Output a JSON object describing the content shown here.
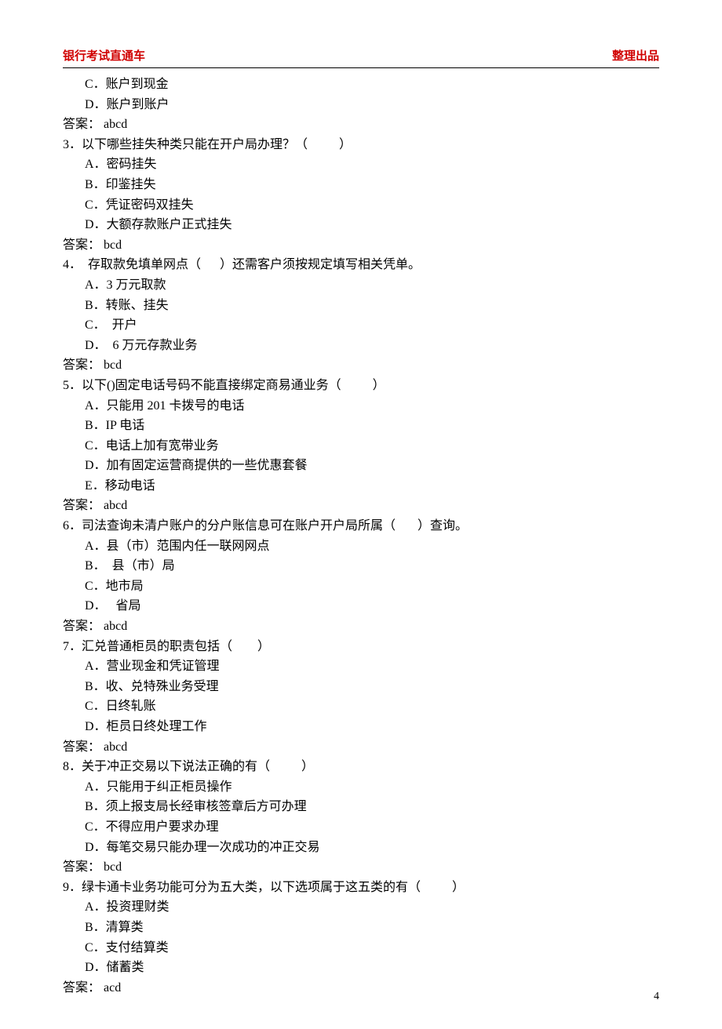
{
  "header": {
    "left": "银行考试直通车",
    "right": "整理出品"
  },
  "lines": [
    {
      "cls": "opt",
      "text": "C．账户到现金"
    },
    {
      "cls": "opt",
      "text": "D．账户到账户"
    },
    {
      "cls": "ans",
      "text": "答案： abcd"
    },
    {
      "cls": "q",
      "text": "3．以下哪些挂失种类只能在开户局办理？（          ）"
    },
    {
      "cls": "opt",
      "text": "A．密码挂失"
    },
    {
      "cls": "opt",
      "text": "B．印鉴挂失"
    },
    {
      "cls": "opt",
      "text": "C．凭证密码双挂失"
    },
    {
      "cls": "opt",
      "text": "D．大额存款账户正式挂失"
    },
    {
      "cls": "ans",
      "text": "答案： bcd"
    },
    {
      "cls": "q",
      "text": "4．  存取款免填单网点（      ）还需客户须按规定填写相关凭单。"
    },
    {
      "cls": "opt",
      "text": "A．3 万元取款"
    },
    {
      "cls": "opt",
      "text": "B．转账、挂失"
    },
    {
      "cls": "opt",
      "text": "C．  开户"
    },
    {
      "cls": "opt",
      "text": "D．  6 万元存款业务"
    },
    {
      "cls": "ans",
      "text": "答案： bcd"
    },
    {
      "cls": "q",
      "text": "5．以下()固定电话号码不能直接绑定商易通业务（          ）"
    },
    {
      "cls": "opt",
      "text": "A．只能用 201 卡拨号的电话"
    },
    {
      "cls": "opt",
      "text": "B．IP 电话"
    },
    {
      "cls": "opt",
      "text": "C．电话上加有宽带业务"
    },
    {
      "cls": "opt",
      "text": "D．加有固定运营商提供的一些优惠套餐"
    },
    {
      "cls": "opt",
      "text": "E．移动电话"
    },
    {
      "cls": "ans",
      "text": "答案： abcd"
    },
    {
      "cls": "q",
      "text": "6．司法查询未清户账户的分户账信息可在账户开户局所属（       ）查询。"
    },
    {
      "cls": "opt",
      "text": "A．县（市）范围内任一联网网点"
    },
    {
      "cls": "opt",
      "text": "B．  县（市）局"
    },
    {
      "cls": "opt",
      "text": "C．地市局"
    },
    {
      "cls": "opt",
      "text": "D．   省局"
    },
    {
      "cls": "ans",
      "text": "答案： abcd"
    },
    {
      "cls": "q",
      "text": "7．汇兑普通柜员的职责包括（        ）"
    },
    {
      "cls": "opt",
      "text": "A．营业现金和凭证管理"
    },
    {
      "cls": "opt",
      "text": "B．收、兑特殊业务受理"
    },
    {
      "cls": "opt",
      "text": "C．日终轧账"
    },
    {
      "cls": "opt",
      "text": "D．柜员日终处理工作"
    },
    {
      "cls": "ans",
      "text": "答案： abcd"
    },
    {
      "cls": "q",
      "text": "8．关于冲正交易以下说法正确的有（          ）"
    },
    {
      "cls": "opt",
      "text": "A．只能用于纠正柜员操作"
    },
    {
      "cls": "opt",
      "text": "B．须上报支局长经审核签章后方可办理"
    },
    {
      "cls": "opt",
      "text": "C．不得应用户要求办理"
    },
    {
      "cls": "opt",
      "text": "D．每笔交易只能办理一次成功的冲正交易"
    },
    {
      "cls": "ans",
      "text": "答案： bcd"
    },
    {
      "cls": "q",
      "text": "9．绿卡通卡业务功能可分为五大类，以下选项属于这五类的有（          ）"
    },
    {
      "cls": "opt",
      "text": "A．投资理财类"
    },
    {
      "cls": "opt",
      "text": "B．清算类"
    },
    {
      "cls": "opt",
      "text": "C．支付结算类"
    },
    {
      "cls": "opt",
      "text": "D．储蓄类"
    },
    {
      "cls": "ans",
      "text": "答案： acd"
    }
  ],
  "page_number": "4"
}
